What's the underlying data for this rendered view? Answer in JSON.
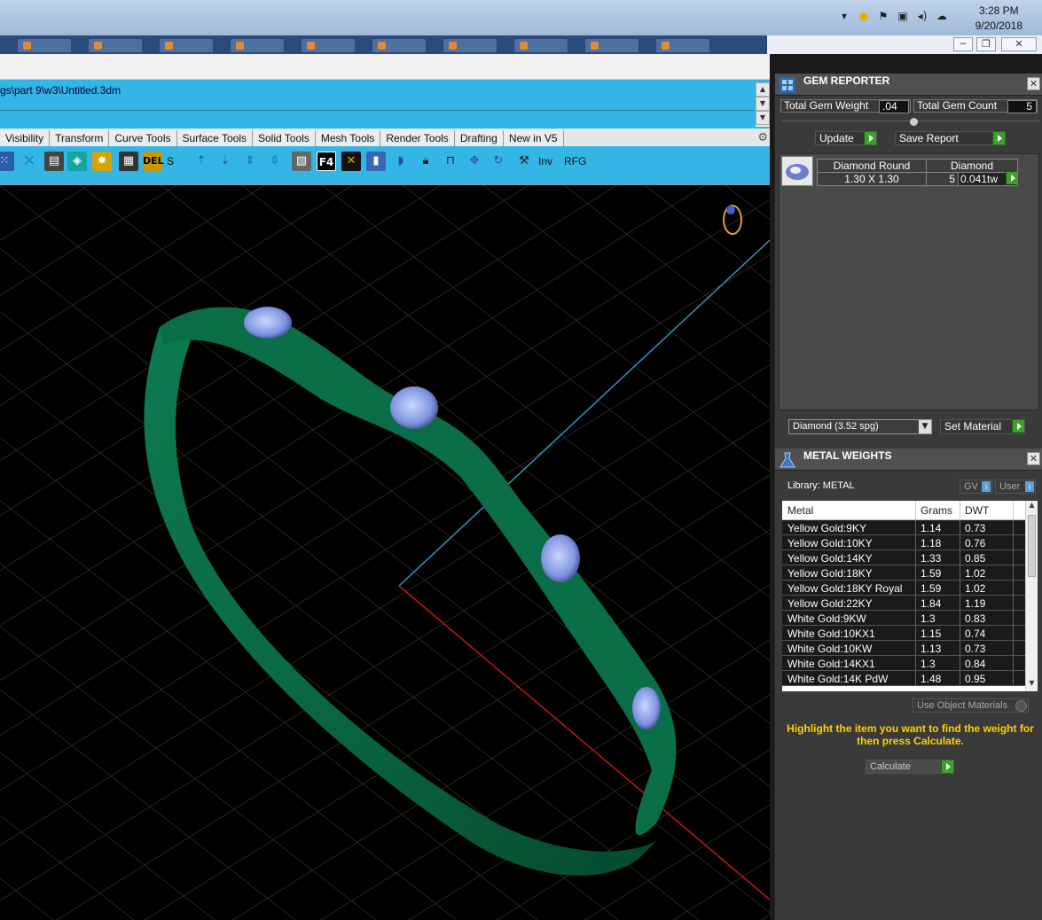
{
  "taskbar": {
    "clock_time": "3:28 PM",
    "clock_date": "9/20/2018",
    "tray_icons": [
      "chevron-up-icon",
      "app-icon",
      "flag-icon",
      "network-icon",
      "volume-icon",
      "cloud-icon"
    ]
  },
  "window": {
    "controls": {
      "minimize": "─",
      "restore": "❐",
      "close": "✕"
    }
  },
  "command": {
    "path_text": "gs\\part 9\\w3\\Untitled.3dm"
  },
  "toolbar_tabs": [
    "Visibility",
    "Transform",
    "Curve Tools",
    "Surface Tools",
    "Solid Tools",
    "Mesh Tools",
    "Render Tools",
    "Drafting",
    "New in V5"
  ],
  "toolbar": {
    "label_s": "S",
    "label_inv": "Inv",
    "label_rfg": "RFG",
    "label_f4": "F4",
    "label_del": "DEL"
  },
  "gem_reporter": {
    "title": "GEM REPORTER",
    "total_weight_label": "Total Gem Weight",
    "total_weight_value": ".04",
    "total_count_label": "Total Gem Count",
    "total_count_value": "5",
    "update_label": "Update",
    "save_label": "Save Report",
    "gem": {
      "shape": "Diamond Round",
      "material": "Diamond",
      "size": "1.30 X 1.30",
      "count": "5",
      "weight": "0.041tw"
    },
    "material_select": "Diamond    (3.52 spg)",
    "set_material_label": "Set Material"
  },
  "metal_weights": {
    "title": "METAL WEIGHTS",
    "library_label": "Library: METAL",
    "gv_label": "GV",
    "user_label": "User",
    "columns": [
      "Metal",
      "Grams",
      "DWT"
    ],
    "rows": [
      [
        "Yellow Gold:9KY",
        "1.14",
        "0.73"
      ],
      [
        "Yellow Gold:10KY",
        "1.18",
        "0.76"
      ],
      [
        "Yellow Gold:14KY",
        "1.33",
        "0.85"
      ],
      [
        "Yellow Gold:18KY",
        "1.59",
        "1.02"
      ],
      [
        "Yellow Gold:18KY Royal",
        "1.59",
        "1.02"
      ],
      [
        "Yellow Gold:22KY",
        "1.84",
        "1.19"
      ],
      [
        "White Gold:9KW",
        "1.3",
        "0.83"
      ],
      [
        "White Gold:10KX1",
        "1.15",
        "0.74"
      ],
      [
        "White Gold:10KW",
        "1.13",
        "0.73"
      ],
      [
        "White Gold:14KX1",
        "1.3",
        "0.84"
      ],
      [
        "White Gold:14K PdW",
        "1.48",
        "0.95"
      ]
    ],
    "use_object_materials": "Use Object Materials",
    "highlight_text": "Highlight the item you want to find the weight for then press Calculate.",
    "calculate_label": "Calculate"
  },
  "colors": {
    "ribbon_blue": "#33b5e5",
    "panel_gray": "#3a3a3a",
    "ring_green": "#0b6b4a",
    "highlight_yellow": "#ffd200",
    "go_green": "#3da028"
  }
}
